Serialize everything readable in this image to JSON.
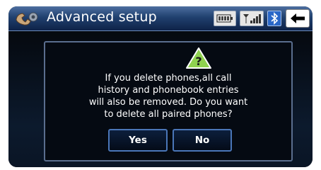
{
  "header": {
    "title": "Advanced setup",
    "icons": [
      "phone-setup-icon",
      "battery-icon",
      "signal-icon",
      "bluetooth-icon",
      "back-arrow-icon"
    ]
  },
  "dialog": {
    "icon": "warning-icon",
    "message_lines": [
      "If you delete phones,all call",
      "history and phonebook entries",
      "will also be removed. Do you want",
      "to delete all paired phones?"
    ],
    "yes_label": "Yes",
    "no_label": "No"
  },
  "colors": {
    "header_top": "#4d6fa0",
    "header_bottom": "#0e2248",
    "background": "#000000",
    "dialog_border": "#5a6e8e",
    "button_border": "#4a76b8",
    "warning_fill": "#8fd14f",
    "bluetooth": "#2a67c8"
  }
}
